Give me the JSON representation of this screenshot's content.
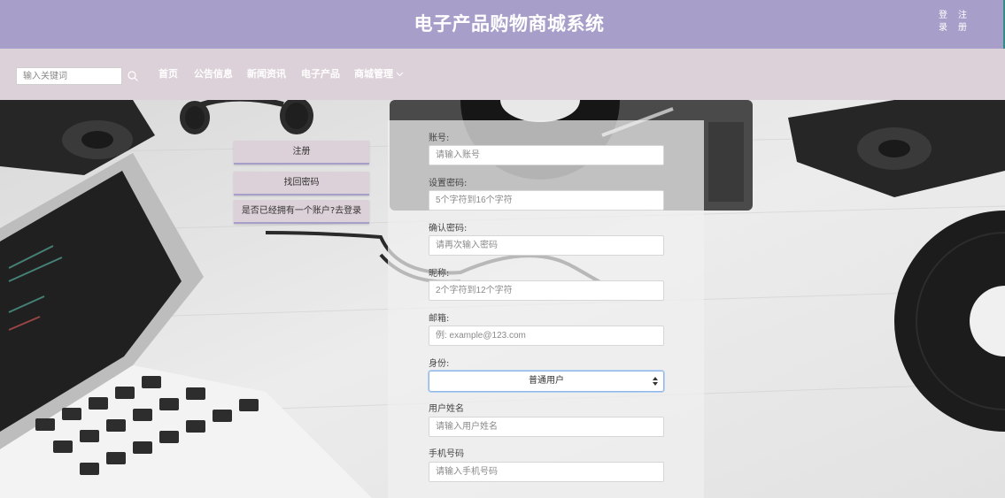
{
  "header": {
    "title": "电子产品购物商城系统",
    "login_chars": [
      "登",
      "录"
    ],
    "register_chars": [
      "注",
      "册"
    ]
  },
  "nav": {
    "search_placeholder": "输入关键词",
    "items": [
      {
        "label": "首页"
      },
      {
        "label": "公告信息"
      },
      {
        "label": "新闻资讯"
      },
      {
        "label": "电子产品"
      },
      {
        "label": "商城管理"
      }
    ]
  },
  "side_menu": {
    "register": "注册",
    "find_password": "找回密码",
    "has_account": "是否已经拥有一个账户?去登录"
  },
  "form": {
    "account": {
      "label": "账号:",
      "placeholder": "请输入账号"
    },
    "password": {
      "label": "设置密码:",
      "placeholder": "5个字符到16个字符"
    },
    "confirm_password": {
      "label": "确认密码:",
      "placeholder": "请再次输入密码"
    },
    "nickname": {
      "label": "昵称:",
      "placeholder": "2个字符到12个字符"
    },
    "email": {
      "label": "邮箱:",
      "placeholder": "例: example@123.com"
    },
    "identity": {
      "label": "身份:",
      "selected": "普通用户"
    },
    "real_name": {
      "label": "用户姓名",
      "placeholder": "请输入用户姓名"
    },
    "phone": {
      "label": "手机号码",
      "placeholder": "请输入手机号码"
    }
  },
  "colors": {
    "header_bg": "#a79fca",
    "nav_bg": "#dcd1d8",
    "accent": "#a79fca"
  }
}
